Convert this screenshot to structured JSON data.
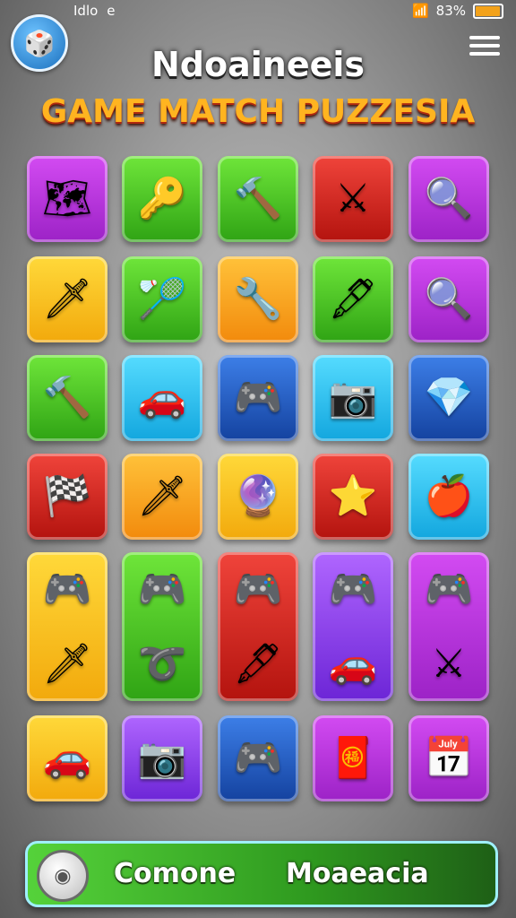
{
  "status_bar": {
    "left_text": "Idlo",
    "left_icon": "e",
    "battery": "83%"
  },
  "header": {
    "title": "Ndoaineeis",
    "subtitle": "GAME MATCH PUZZESIA"
  },
  "board": {
    "row1": [
      {
        "color": "purple",
        "icon": "map-icon",
        "glyph": "🗺"
      },
      {
        "color": "green",
        "icon": "whistle-icon",
        "glyph": "🔑"
      },
      {
        "color": "green",
        "icon": "hammer-keychain-icon",
        "glyph": "🔨"
      },
      {
        "color": "red",
        "icon": "crossed-spears-icon",
        "glyph": "⚔"
      },
      {
        "color": "purple",
        "icon": "magnifier-icon",
        "glyph": "🔍"
      }
    ],
    "row2": [
      {
        "color": "yellow",
        "icon": "kunai-icon",
        "glyph": "🗡"
      },
      {
        "color": "green",
        "icon": "feather-shuttle-icon",
        "glyph": "🏸"
      },
      {
        "color": "orange",
        "icon": "pocket-knife-icon",
        "glyph": "🔧"
      },
      {
        "color": "green",
        "icon": "pen-nib-icon",
        "glyph": "🖋"
      },
      {
        "color": "purple",
        "icon": "magnifier-icon",
        "glyph": "🔍"
      }
    ],
    "row3": [
      {
        "color": "green",
        "icon": "hammer-keychain-icon",
        "glyph": "🔨"
      },
      {
        "color": "cyan",
        "icon": "car-icon",
        "glyph": "🚗"
      },
      {
        "color": "blue",
        "icon": "gamepad-icon",
        "glyph": "🎮"
      },
      {
        "color": "cyan",
        "icon": "camera-lens-icon",
        "glyph": "📷"
      },
      {
        "color": "blue",
        "icon": "gem-bag-icon",
        "glyph": "💎"
      }
    ],
    "row4": [
      {
        "color": "red",
        "icon": "checkered-board-icon",
        "glyph": "🏁"
      },
      {
        "color": "orange",
        "icon": "crystal-sword-icon",
        "glyph": "🗡"
      },
      {
        "color": "yellow",
        "icon": "crystal-ball-icon",
        "glyph": "🔮"
      },
      {
        "color": "red",
        "icon": "star-necklace-icon",
        "glyph": "⭐"
      },
      {
        "color": "cyan",
        "icon": "apple-pin-icon",
        "glyph": "🍎"
      }
    ],
    "row5": [
      {
        "color": "yellow",
        "icon": "gamepad-icon",
        "icon2": "dagger-icon",
        "glyph": "🎮",
        "glyph2": "🗡"
      },
      {
        "color": "green",
        "icon": "gamepad-icon",
        "icon2": "rope-coil-icon",
        "glyph": "🎮",
        "glyph2": "➰"
      },
      {
        "color": "red",
        "icon": "gamepad-icon",
        "icon2": "pen-nib-icon",
        "glyph": "🎮",
        "glyph2": "🖋"
      },
      {
        "color": "violet",
        "icon": "gamepad-icon",
        "icon2": "car-icon",
        "glyph": "🎮",
        "glyph2": "🚗"
      },
      {
        "color": "purple",
        "icon": "gamepad-icon",
        "icon2": "crossed-weapons-icon",
        "glyph": "🎮",
        "glyph2": "⚔"
      }
    ],
    "row6": [
      {
        "color": "yellow",
        "icon": "car-icon",
        "glyph": "🚗"
      },
      {
        "color": "violet",
        "icon": "camera-lens-icon",
        "glyph": "📷"
      },
      {
        "color": "blue",
        "icon": "gamepad-icon",
        "glyph": "🎮"
      },
      {
        "color": "purple",
        "icon": "cape-icon",
        "glyph": "🧧"
      },
      {
        "color": "purple",
        "icon": "calendar-board-icon",
        "glyph": "📅"
      }
    ]
  },
  "bottom_bar": {
    "left_label": "Comone",
    "right_label": "Moaeacia"
  }
}
